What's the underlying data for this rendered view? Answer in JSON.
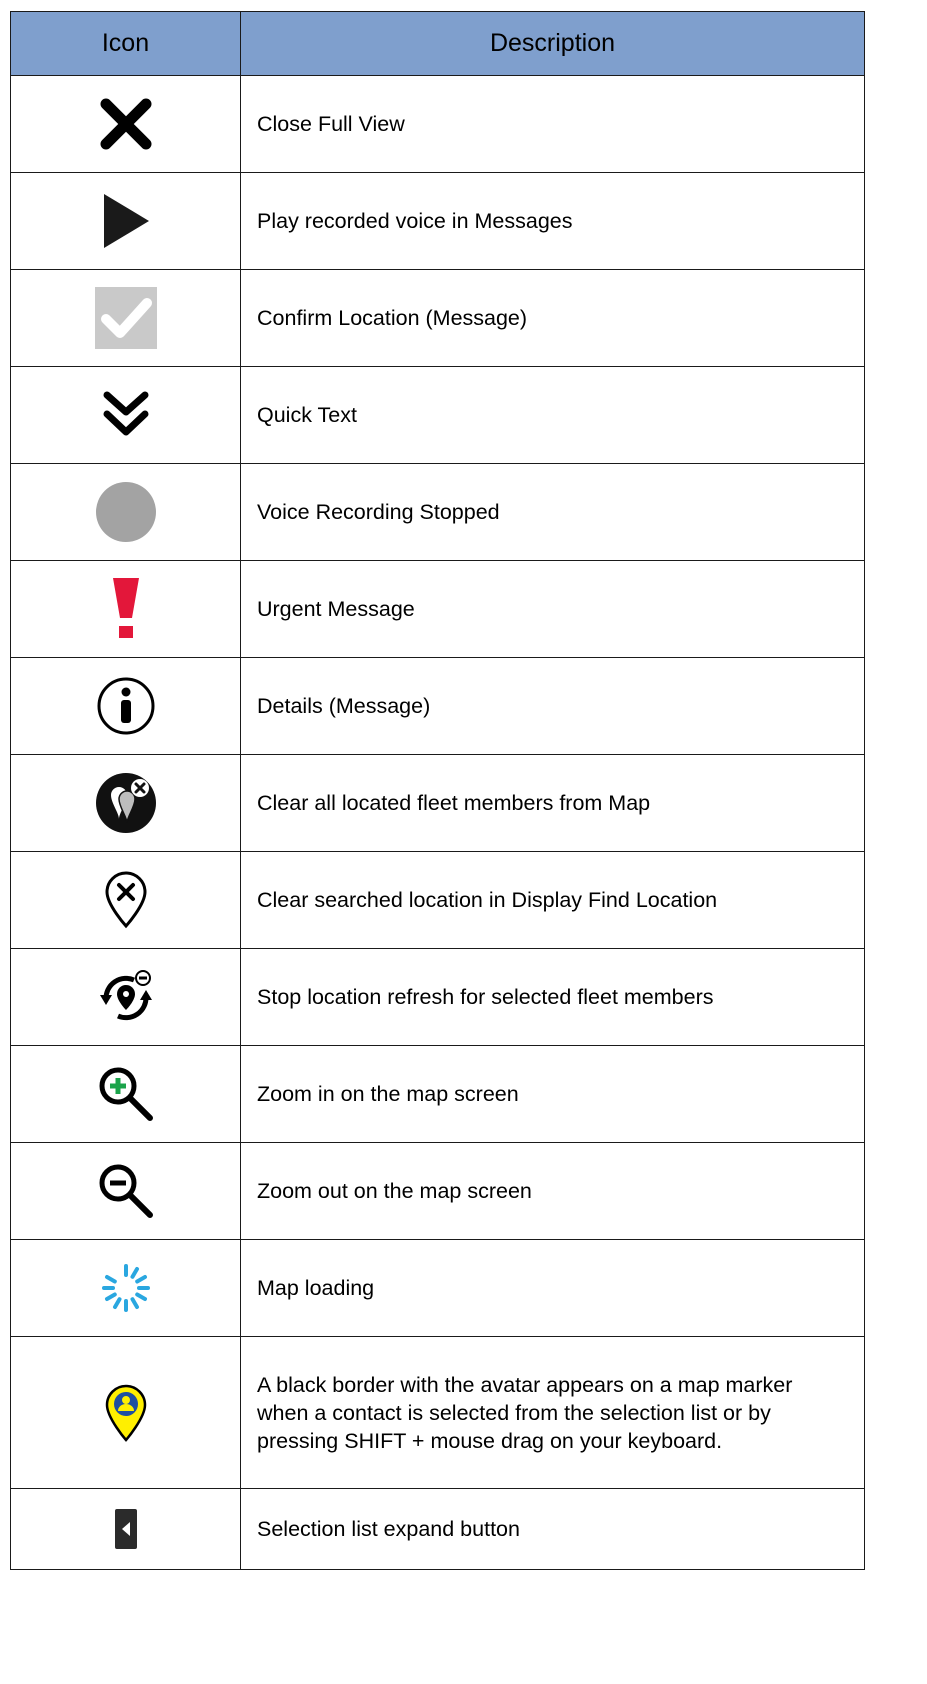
{
  "header": {
    "icon_col": "Icon",
    "description_col": "Description"
  },
  "rows": [
    {
      "icon": "close-icon",
      "description": "Close Full View"
    },
    {
      "icon": "play-icon",
      "description": "Play recorded voice in Messages"
    },
    {
      "icon": "checkmark-icon",
      "description": "Confirm Location (Message)"
    },
    {
      "icon": "double-chevron-down-icon",
      "description": "Quick Text"
    },
    {
      "icon": "gray-circle-icon",
      "description": "Voice Recording Stopped"
    },
    {
      "icon": "exclamation-icon",
      "description": "Urgent Message"
    },
    {
      "icon": "info-icon",
      "description": "Details (Message)"
    },
    {
      "icon": "clear-fleet-members-icon",
      "description": "Clear all located fleet members from Map"
    },
    {
      "icon": "clear-location-pin-icon",
      "description": "Clear searched location in Display Find Location"
    },
    {
      "icon": "stop-refresh-icon",
      "description": "Stop location refresh for selected fleet members"
    },
    {
      "icon": "zoom-in-icon",
      "description": "Zoom in on the map screen"
    },
    {
      "icon": "zoom-out-icon",
      "description": "Zoom out on the map screen"
    },
    {
      "icon": "loading-spinner-icon",
      "description": "Map loading"
    },
    {
      "icon": "avatar-map-marker-icon",
      "description": "A black border with the avatar appears on a map marker when a contact is selected from the selection list or by pressing SHIFT + mouse drag on your keyboard."
    },
    {
      "icon": "expand-arrow-icon",
      "description": "Selection list expand button"
    }
  ],
  "colors": {
    "header_bg": "#7f9fcd",
    "urgent_red": "#e3173a",
    "zoom_in_green": "#1aa34a",
    "spinner_blue": "#2aa7e0",
    "marker_yellow": "#ffef00",
    "avatar_blue": "#1f4fa0"
  }
}
